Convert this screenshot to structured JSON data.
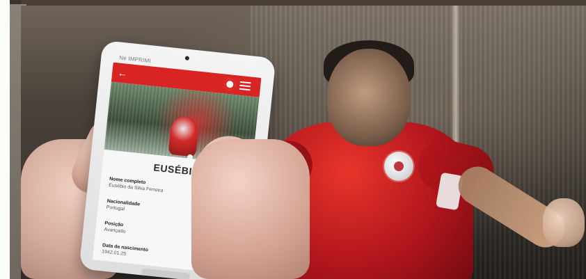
{
  "scene": {
    "tablet_app": {
      "status_text": "Ne IMPRIMI",
      "player_name": "EUSÉBIO",
      "fields": [
        {
          "label": "Nome completo",
          "value": "Eusébio da Silva Ferreira"
        },
        {
          "label": "Nacionalidade",
          "value": "Portugal"
        },
        {
          "label": "Posição",
          "value": "Avançado"
        },
        {
          "label": "Data de nascimento",
          "value": "1942.01.25"
        }
      ],
      "icons": {
        "back": "arrow-left-icon",
        "club": "club-crest-icon",
        "menu": "hamburger-menu-icon"
      },
      "colors": {
        "accent": "#d92424"
      }
    }
  }
}
